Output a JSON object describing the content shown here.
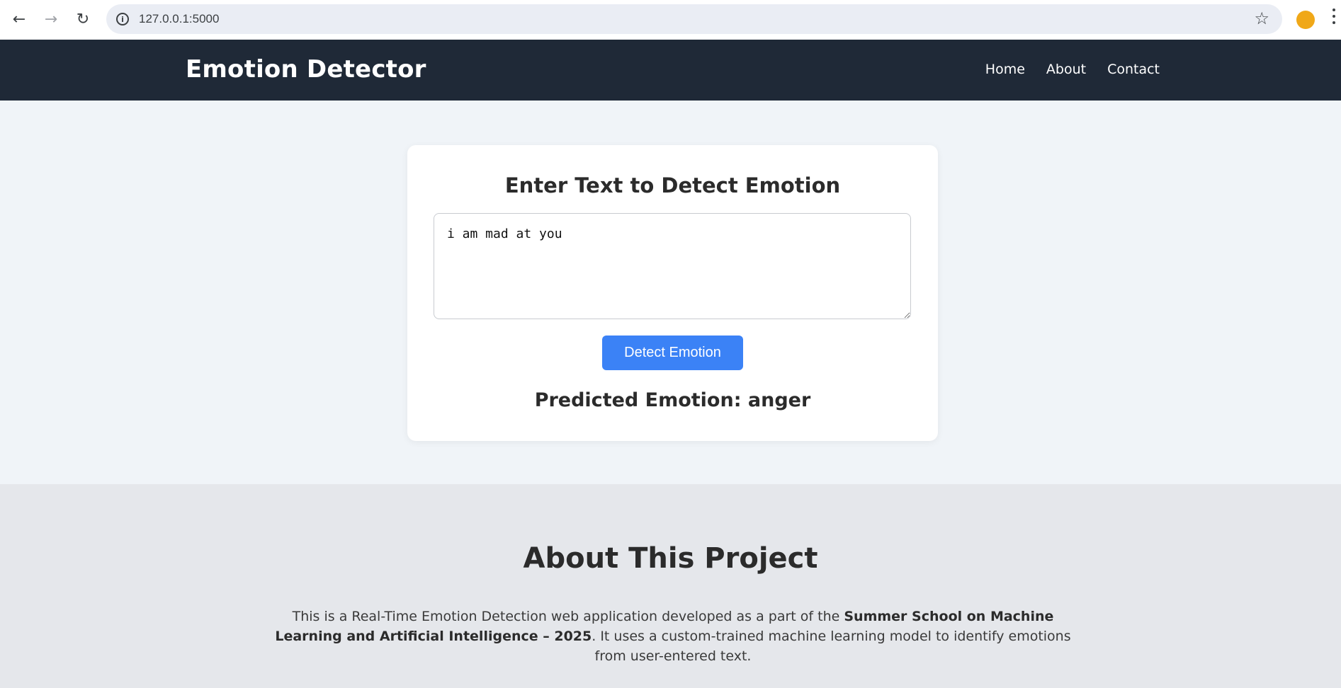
{
  "browser": {
    "url": "127.0.0.1:5000",
    "back_icon": "arrow-left-icon",
    "forward_icon": "arrow-right-icon",
    "reload_icon": "reload-icon",
    "info_icon": "info-icon",
    "bookmark_icon": "star-icon",
    "menu_icon": "kebab-menu-icon",
    "avatar_color": "#f0a818"
  },
  "header": {
    "brand": "Emotion Detector",
    "nav": [
      "Home",
      "About",
      "Contact"
    ],
    "background": "#1f2937"
  },
  "detector": {
    "title": "Enter Text to Detect Emotion",
    "input_value": "i am mad at you",
    "button_label": "Detect Emotion",
    "button_color": "#3b82f6",
    "prediction_label": "Predicted Emotion:",
    "prediction_value": "anger"
  },
  "about": {
    "title": "About This Project",
    "text_part1": "This is a Real-Time Emotion Detection web application developed as a part of the ",
    "text_bold": "Summer School on Machine Learning and Artificial Intelligence – 2025",
    "text_part2": ". It uses a custom-trained machine learning model to identify emotions from user-entered text."
  }
}
